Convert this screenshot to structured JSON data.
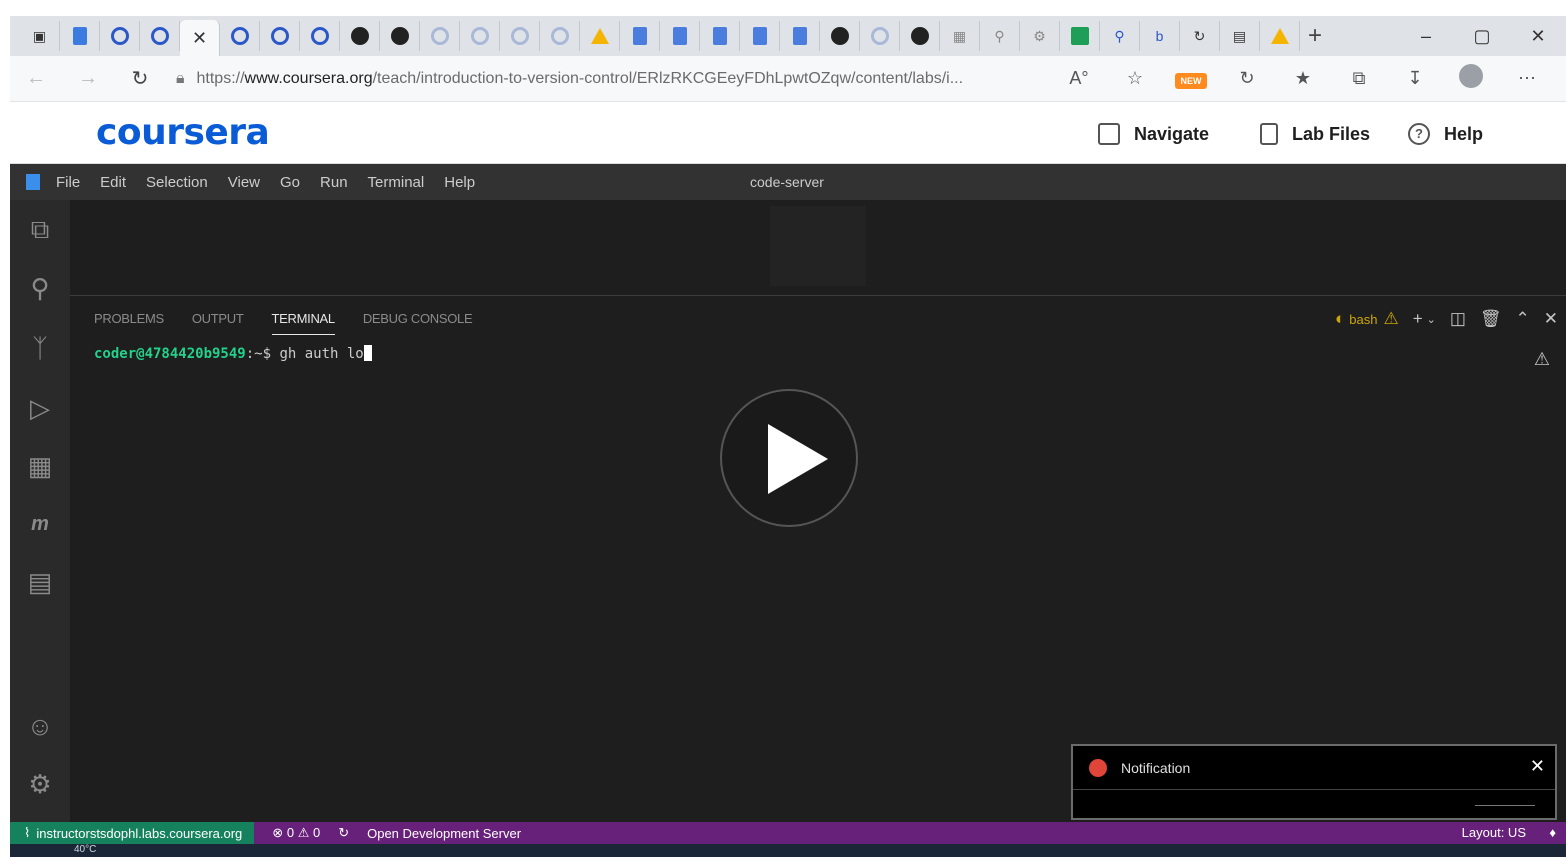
{
  "browser": {
    "url_prefix": "https://",
    "url_domain": "www.coursera.org",
    "url_path": "/teach/introduction-to-version-control/ERlzRKCGEeyFDhLpwtOZqw/content/labs/i...",
    "read_aloud_label": "A°",
    "new_badge": "NEW",
    "window_controls": [
      "–",
      "▢",
      "✕"
    ]
  },
  "coursera": {
    "logo": "coursera",
    "navigate_label": "Navigate",
    "lab_files_label": "Lab Files",
    "help_label": "Help"
  },
  "vscode": {
    "menu": [
      "File",
      "Edit",
      "Selection",
      "View",
      "Go",
      "Run",
      "Terminal",
      "Help"
    ],
    "window_title": "code-server",
    "panel_tabs": [
      "PROBLEMS",
      "OUTPUT",
      "TERMINAL",
      "DEBUG CONSOLE"
    ],
    "shell_label": "bash",
    "terminal": {
      "prompt_user": "coder@4784420b9549",
      "prompt_sep": ":~$ ",
      "command": "gh auth lo"
    },
    "statusbar": {
      "remote": "instructorstsdophl.labs.coursera.org",
      "errors": "0",
      "warnings": "0",
      "dev_server": "Open Development Server",
      "layout": "Layout: US"
    }
  },
  "notification": {
    "title": "Notification"
  },
  "taskbar": {
    "temperature": "40°C"
  }
}
